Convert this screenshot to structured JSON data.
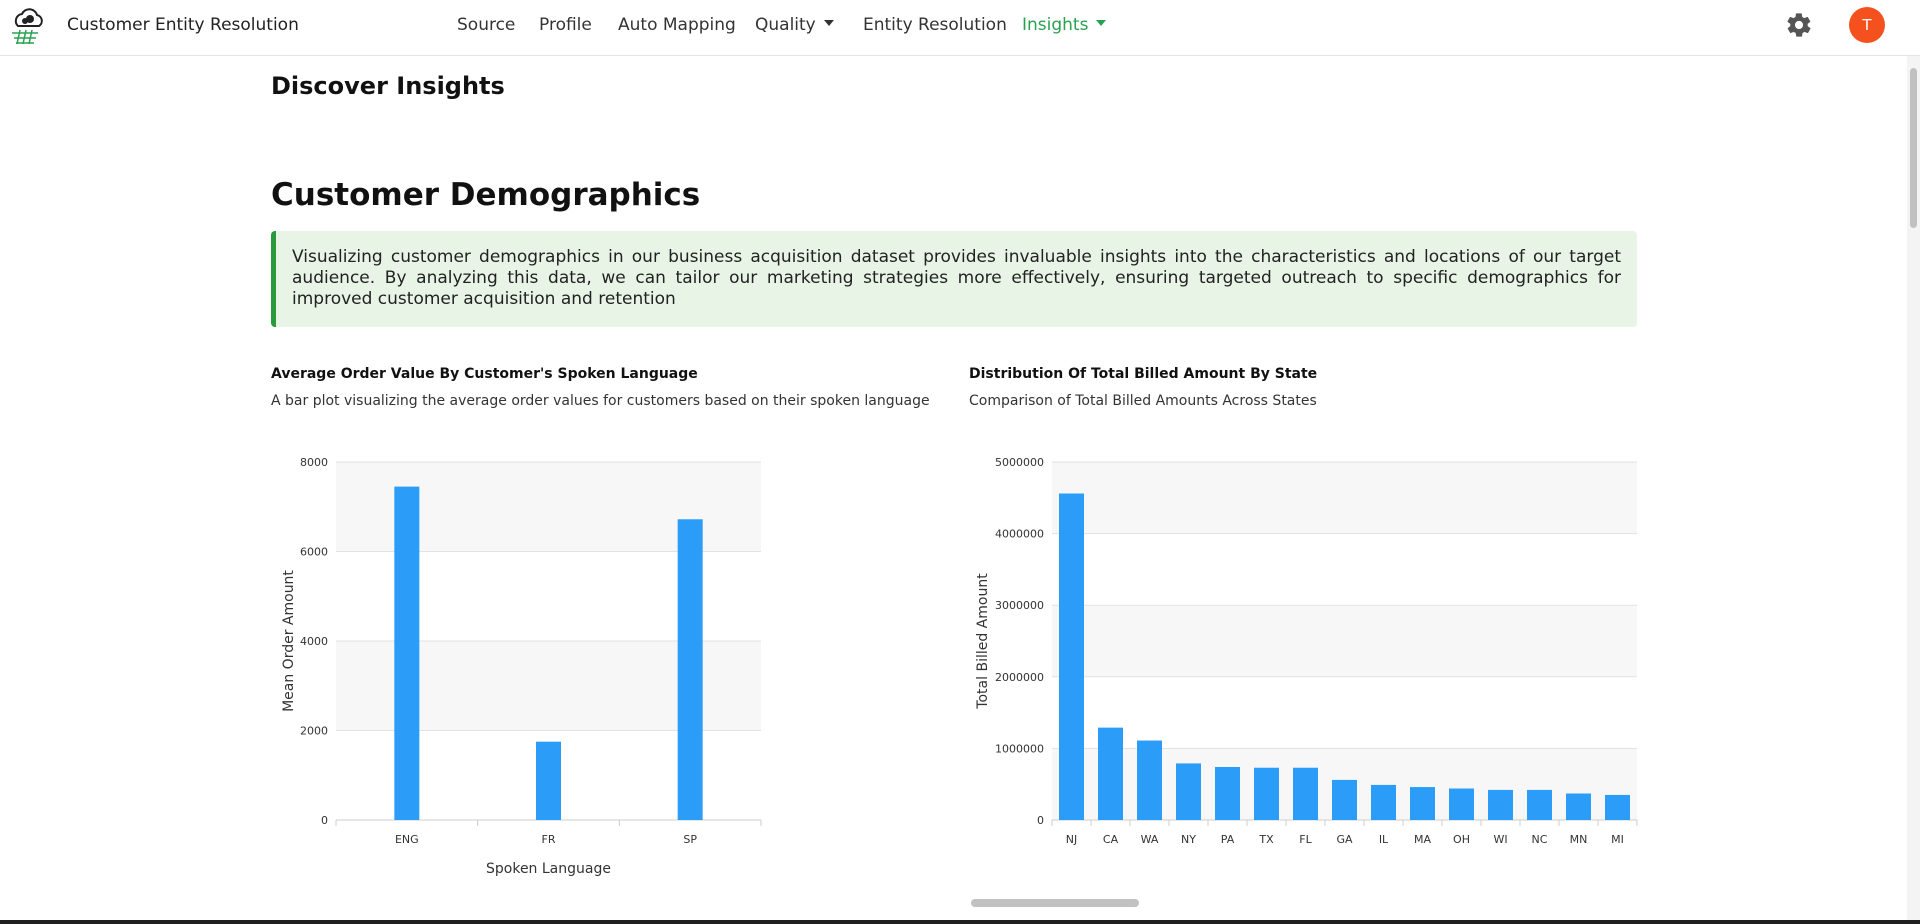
{
  "app": {
    "title": "Customer Entity Resolution",
    "avatar_initial": "T"
  },
  "nav": {
    "items": [
      {
        "label": "Source",
        "active": false,
        "dropdown": false
      },
      {
        "label": "Profile",
        "active": false,
        "dropdown": false
      },
      {
        "label": "Auto Mapping",
        "active": false,
        "dropdown": false
      },
      {
        "label": "Quality",
        "active": false,
        "dropdown": true
      },
      {
        "label": "Entity Resolution",
        "active": false,
        "dropdown": false
      },
      {
        "label": "Insights",
        "active": true,
        "dropdown": true
      }
    ]
  },
  "colors": {
    "accent": "#2aa150",
    "callout_bg": "#e8f5e6",
    "callout_border": "#2a9a3c",
    "bar": "#2b9cf7",
    "avatar": "#f4511e"
  },
  "page": {
    "heading": "Discover Insights",
    "section_heading": "Customer Demographics",
    "callout": "Visualizing customer demographics in our business acquisition dataset provides invaluable insights into the characteristics and locations of our target audience. By analyzing this data, we can tailor our marketing strategies more effectively, ensuring targeted outreach to specific demographics for improved customer acquisition and retention"
  },
  "charts": {
    "language": {
      "title": "Average Order Value By Customer's Spoken Language",
      "subtitle": "A bar plot visualizing the average order values for customers based on their spoken language"
    },
    "state": {
      "title": "Distribution Of Total Billed Amount By State",
      "subtitle": "Comparison of Total Billed Amounts Across States"
    }
  },
  "chart_data": [
    {
      "type": "bar",
      "categories": [
        "ENG",
        "FR",
        "SP"
      ],
      "values": [
        7450,
        1750,
        6720
      ],
      "xlabel": "Spoken Language",
      "ylabel": "Mean Order Amount",
      "ylim": [
        0,
        8000
      ],
      "yticks": [
        "0",
        "2000",
        "4000",
        "6000",
        "8000"
      ],
      "grid": true
    },
    {
      "type": "bar",
      "categories": [
        "NJ",
        "CA",
        "WA",
        "NY",
        "PA",
        "TX",
        "FL",
        "GA",
        "IL",
        "MA",
        "OH",
        "WI",
        "NC",
        "MN",
        "MI"
      ],
      "values": [
        4560000,
        1290000,
        1110000,
        790000,
        740000,
        730000,
        730000,
        560000,
        490000,
        460000,
        440000,
        420000,
        420000,
        370000,
        350000
      ],
      "xlabel": "",
      "ylabel": "Total Billed Amount",
      "ylim": [
        0,
        5000000
      ],
      "yticks": [
        "0",
        "1000000",
        "2000000",
        "3000000",
        "4000000",
        "5000000"
      ],
      "grid": true
    }
  ]
}
